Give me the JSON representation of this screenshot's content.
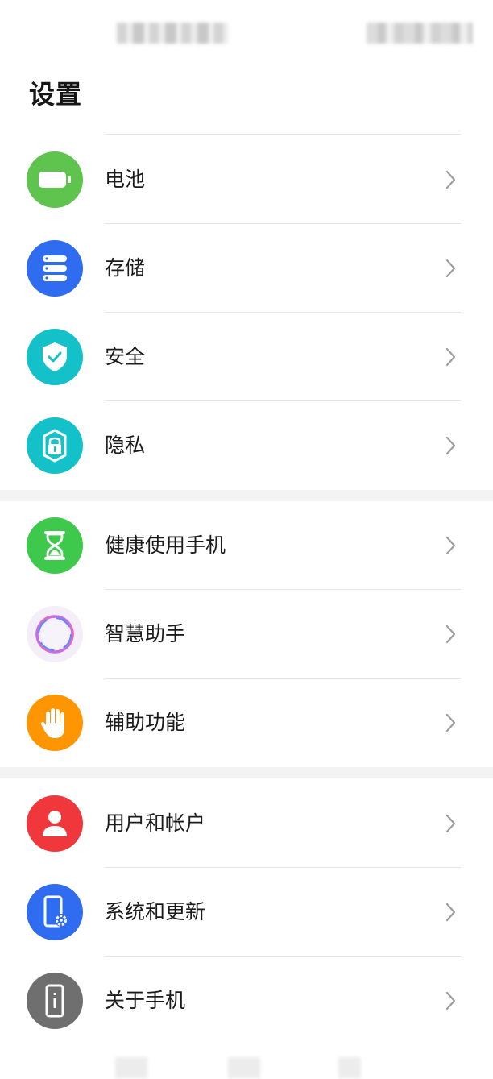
{
  "header": {
    "title": "设置"
  },
  "groups": [
    {
      "items": [
        {
          "label": "电池",
          "icon": "battery-icon",
          "color": "#5ec44e"
        },
        {
          "label": "存储",
          "icon": "storage-icon",
          "color": "#2f6cf0"
        },
        {
          "label": "安全",
          "icon": "shield-icon",
          "color": "#14c1c9"
        },
        {
          "label": "隐私",
          "icon": "privacy-lock-icon",
          "color": "#14c1c9"
        }
      ]
    },
    {
      "items": [
        {
          "label": "健康使用手机",
          "icon": "hourglass-icon",
          "color": "#3ec94d"
        },
        {
          "label": "智慧助手",
          "icon": "smart-assistant-icon",
          "color": "#f1ecf8"
        },
        {
          "label": "辅助功能",
          "icon": "hand-icon",
          "color": "#ff9500"
        }
      ]
    },
    {
      "items": [
        {
          "label": "用户和帐户",
          "icon": "user-icon",
          "color": "#f0373c"
        },
        {
          "label": "系统和更新",
          "icon": "system-update-icon",
          "color": "#2f6cf0"
        },
        {
          "label": "关于手机",
          "icon": "phone-info-icon",
          "color": "#6f6f6f"
        }
      ]
    }
  ]
}
